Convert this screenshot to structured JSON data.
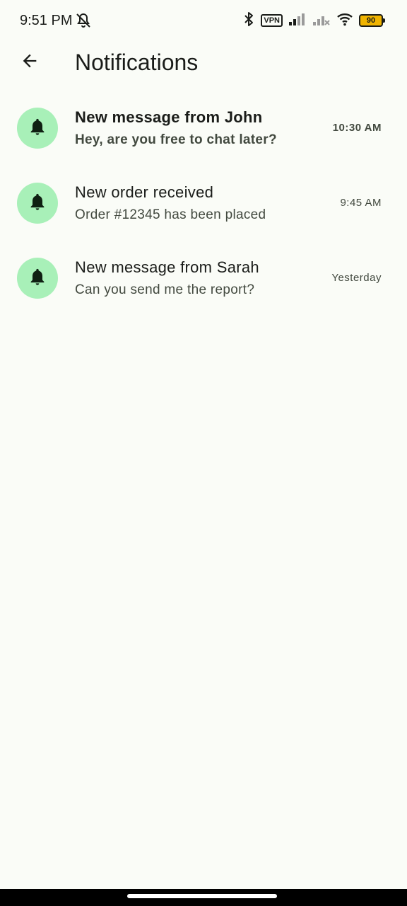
{
  "status_bar": {
    "time": "9:51 PM",
    "vpn_label": "VPN",
    "battery_level": "90",
    "icons": [
      "mute-icon",
      "bluetooth-icon",
      "vpn-icon",
      "signal-icon",
      "signal-no-service-icon",
      "wifi-icon",
      "battery-icon"
    ]
  },
  "app_bar": {
    "title": "Notifications",
    "back_icon": "arrow-back-icon"
  },
  "notifications": [
    {
      "title": "New message from John",
      "body": "Hey, are you free to chat later?",
      "time": "10:30 AM",
      "unread": true,
      "icon": "bell-icon"
    },
    {
      "title": "New order received",
      "body": "Order #12345 has been placed",
      "time": "9:45 AM",
      "unread": false,
      "icon": "bell-icon"
    },
    {
      "title": "New message from Sarah",
      "body": "Can you send me the report?",
      "time": "Yesterday",
      "unread": false,
      "icon": "bell-icon"
    }
  ],
  "colors": {
    "background": "#fafcf7",
    "avatar_bg": "#a8f0b8",
    "icon_dark": "#0f1f12",
    "text_primary": "#1a1c19",
    "text_secondary": "#42493f"
  }
}
